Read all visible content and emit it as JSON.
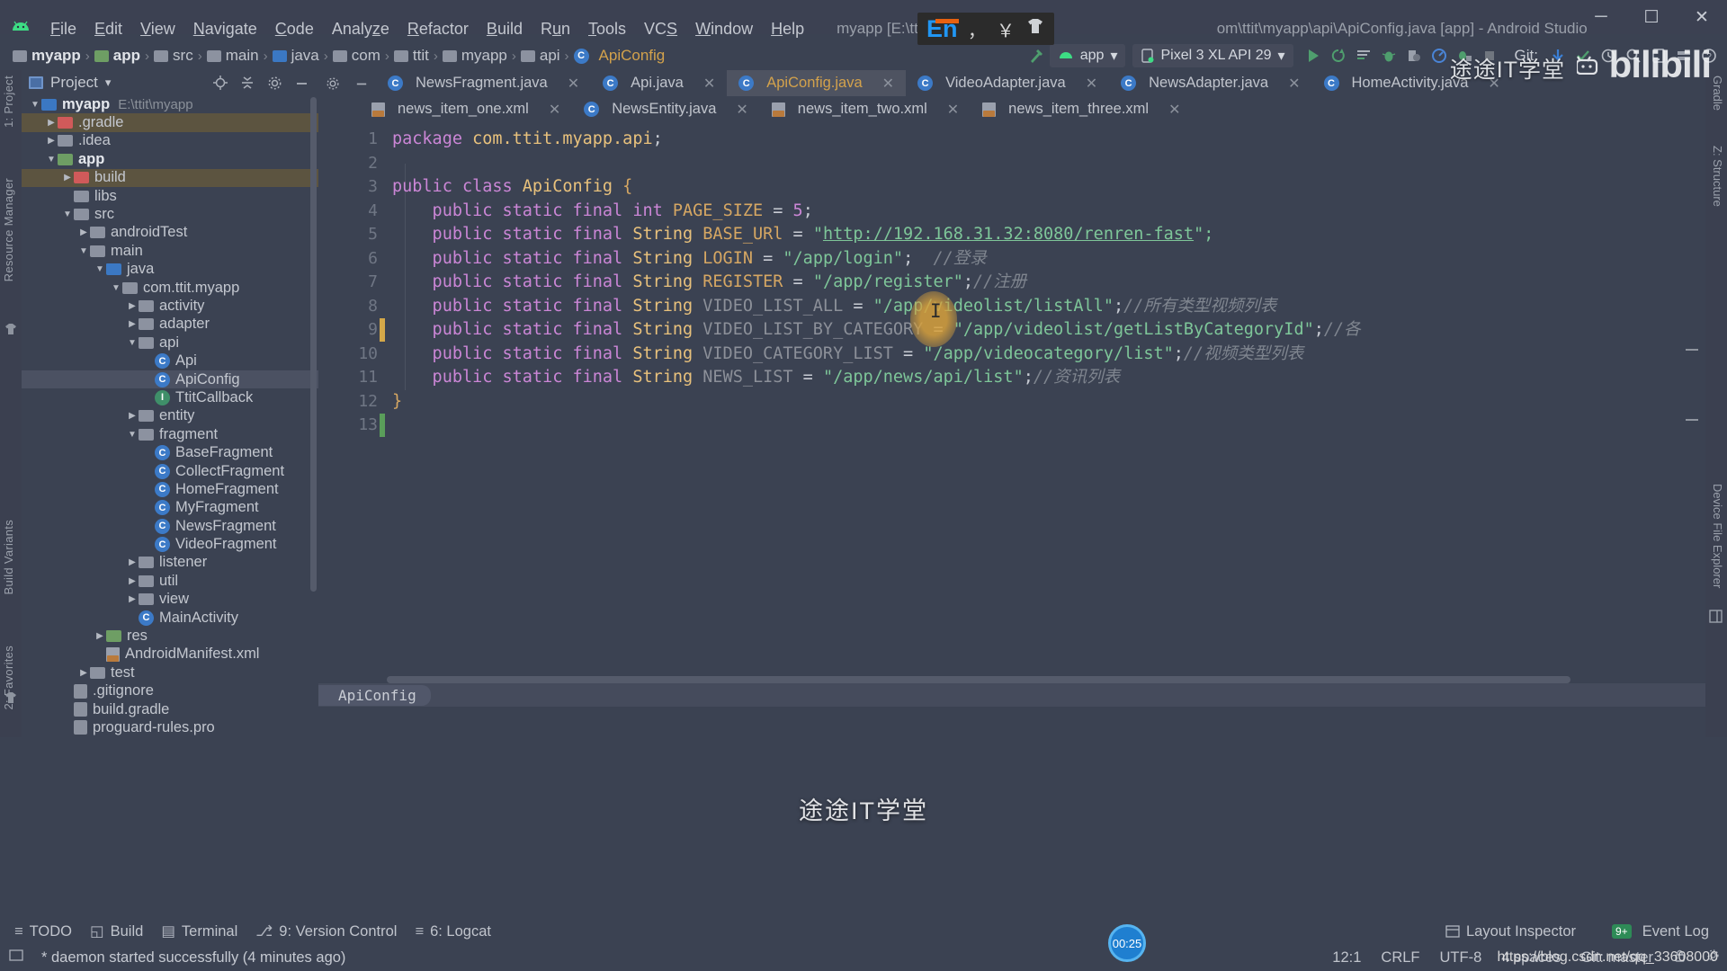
{
  "window": {
    "title": "myapp [E:\\ttit\\myapp] - ...\\ap",
    "title_tail": "om\\ttit\\myapp\\api\\ApiConfig.java [app] - Android Studio",
    "minimize": "─",
    "maximize": "☐",
    "close": "✕"
  },
  "menu": {
    "items": [
      "File",
      "Edit",
      "View",
      "Navigate",
      "Code",
      "Analyze",
      "Refactor",
      "Build",
      "Run",
      "Tools",
      "VCS",
      "Window",
      "Help"
    ]
  },
  "ime": {
    "lang": "En",
    "punct": "，",
    "currency": "￥",
    "shirt": "👕"
  },
  "watermark": {
    "brand": "途途IT学堂",
    "bili": "bilibili",
    "center": "途途IT学堂",
    "blog": "https://blog.csdn.net/qq_33608000"
  },
  "breadcrumb": {
    "items": [
      {
        "label": "myapp",
        "icon": "folder-gray",
        "bold": true
      },
      {
        "label": "app",
        "icon": "folder-green",
        "bold": true
      },
      {
        "label": "src",
        "icon": "folder-gray",
        "bold": false
      },
      {
        "label": "main",
        "icon": "folder-gray",
        "bold": false
      },
      {
        "label": "java",
        "icon": "folder-blue",
        "bold": false
      },
      {
        "label": "com",
        "icon": "folder-gray",
        "bold": false
      },
      {
        "label": "ttit",
        "icon": "folder-gray",
        "bold": false
      },
      {
        "label": "myapp",
        "icon": "folder-gray",
        "bold": false
      },
      {
        "label": "api",
        "icon": "folder-gray",
        "bold": false
      },
      {
        "label": "ApiConfig",
        "icon": "class",
        "bold": false
      }
    ],
    "separator": "›"
  },
  "toolbar": {
    "module_chip": "app",
    "device_chip": "Pixel 3 XL API 29",
    "dropdown_caret": "▾",
    "git_label": "Git:",
    "icons": [
      "hammer-icon",
      "run-icon",
      "rerun-icon",
      "apply-changes-icon",
      "debug-icon",
      "profile-icon",
      "analyze-icon",
      "attach-debugger-icon",
      "stop-icon",
      "vcs-update-icon",
      "vcs-commit-icon",
      "vcs-history-icon",
      "search-icon",
      "avd-manager-icon",
      "sdk-manager-icon",
      "settings-icon"
    ]
  },
  "left_strip": {
    "project": "1: Project",
    "resource_manager": "Resource Manager",
    "build_variants": "Build Variants",
    "favorites": "2: Favorites"
  },
  "right_strip": {
    "gradle": "Gradle",
    "structure": "Z: Structure",
    "device_file_explorer": "Device File Explorer"
  },
  "project_panel": {
    "title": "Project",
    "caret": "▾",
    "locate_icon": "locate-icon",
    "collapse_icon": "collapse-all-icon",
    "minimize_icon": "minimize-icon",
    "tree": [
      {
        "depth": 0,
        "arrow": "down",
        "icon": "folder-blue-module",
        "label": "myapp",
        "bold": true,
        "path": "E:\\ttit\\myapp",
        "highlight": ""
      },
      {
        "depth": 1,
        "arrow": "right",
        "icon": "folder-red",
        "label": ".gradle",
        "bold": false,
        "path": "",
        "highlight": "tan"
      },
      {
        "depth": 1,
        "arrow": "right",
        "icon": "folder-gray",
        "label": ".idea",
        "bold": false,
        "path": "",
        "highlight": ""
      },
      {
        "depth": 1,
        "arrow": "down",
        "icon": "folder-module-green",
        "label": "app",
        "bold": true,
        "path": "",
        "highlight": ""
      },
      {
        "depth": 2,
        "arrow": "right",
        "icon": "folder-red",
        "label": "build",
        "bold": false,
        "path": "",
        "highlight": "tan"
      },
      {
        "depth": 2,
        "arrow": "none",
        "icon": "folder-gray",
        "label": "libs",
        "bold": false,
        "path": "",
        "highlight": ""
      },
      {
        "depth": 2,
        "arrow": "down",
        "icon": "folder-gray",
        "label": "src",
        "bold": false,
        "path": "",
        "highlight": ""
      },
      {
        "depth": 3,
        "arrow": "right",
        "icon": "folder-gray",
        "label": "androidTest",
        "bold": false,
        "path": "",
        "highlight": ""
      },
      {
        "depth": 3,
        "arrow": "down",
        "icon": "folder-gray",
        "label": "main",
        "bold": false,
        "path": "",
        "highlight": ""
      },
      {
        "depth": 4,
        "arrow": "down",
        "icon": "folder-blue",
        "label": "java",
        "bold": false,
        "path": "",
        "highlight": ""
      },
      {
        "depth": 5,
        "arrow": "down",
        "icon": "folder-gray",
        "label": "com.ttit.myapp",
        "bold": false,
        "path": "",
        "highlight": ""
      },
      {
        "depth": 6,
        "arrow": "right",
        "icon": "folder-gray",
        "label": "activity",
        "bold": false,
        "path": "",
        "highlight": ""
      },
      {
        "depth": 6,
        "arrow": "right",
        "icon": "folder-gray",
        "label": "adapter",
        "bold": false,
        "path": "",
        "highlight": ""
      },
      {
        "depth": 6,
        "arrow": "down",
        "icon": "folder-gray",
        "label": "api",
        "bold": false,
        "path": "",
        "highlight": ""
      },
      {
        "depth": 7,
        "arrow": "none",
        "icon": "class",
        "label": "Api",
        "bold": false,
        "path": "",
        "highlight": ""
      },
      {
        "depth": 7,
        "arrow": "none",
        "icon": "class",
        "label": "ApiConfig",
        "bold": false,
        "path": "",
        "highlight": "selected"
      },
      {
        "depth": 7,
        "arrow": "none",
        "icon": "interface",
        "label": "TtitCallback",
        "bold": false,
        "path": "",
        "highlight": ""
      },
      {
        "depth": 6,
        "arrow": "right",
        "icon": "folder-gray",
        "label": "entity",
        "bold": false,
        "path": "",
        "highlight": ""
      },
      {
        "depth": 6,
        "arrow": "down",
        "icon": "folder-gray",
        "label": "fragment",
        "bold": false,
        "path": "",
        "highlight": ""
      },
      {
        "depth": 7,
        "arrow": "none",
        "icon": "class",
        "label": "BaseFragment",
        "bold": false,
        "path": "",
        "highlight": ""
      },
      {
        "depth": 7,
        "arrow": "none",
        "icon": "class",
        "label": "CollectFragment",
        "bold": false,
        "path": "",
        "highlight": ""
      },
      {
        "depth": 7,
        "arrow": "none",
        "icon": "class",
        "label": "HomeFragment",
        "bold": false,
        "path": "",
        "highlight": ""
      },
      {
        "depth": 7,
        "arrow": "none",
        "icon": "class",
        "label": "MyFragment",
        "bold": false,
        "path": "",
        "highlight": ""
      },
      {
        "depth": 7,
        "arrow": "none",
        "icon": "class",
        "label": "NewsFragment",
        "bold": false,
        "path": "",
        "highlight": ""
      },
      {
        "depth": 7,
        "arrow": "none",
        "icon": "class",
        "label": "VideoFragment",
        "bold": false,
        "path": "",
        "highlight": ""
      },
      {
        "depth": 6,
        "arrow": "right",
        "icon": "folder-gray",
        "label": "listener",
        "bold": false,
        "path": "",
        "highlight": ""
      },
      {
        "depth": 6,
        "arrow": "right",
        "icon": "folder-gray",
        "label": "util",
        "bold": false,
        "path": "",
        "highlight": ""
      },
      {
        "depth": 6,
        "arrow": "right",
        "icon": "folder-gray",
        "label": "view",
        "bold": false,
        "path": "",
        "highlight": ""
      },
      {
        "depth": 6,
        "arrow": "none",
        "icon": "class",
        "label": "MainActivity",
        "bold": false,
        "path": "",
        "highlight": ""
      },
      {
        "depth": 4,
        "arrow": "right",
        "icon": "folder-res",
        "label": "res",
        "bold": false,
        "path": "",
        "highlight": ""
      },
      {
        "depth": 4,
        "arrow": "none",
        "icon": "xml",
        "label": "AndroidManifest.xml",
        "bold": false,
        "path": "",
        "highlight": ""
      },
      {
        "depth": 3,
        "arrow": "right",
        "icon": "folder-gray",
        "label": "test",
        "bold": false,
        "path": "",
        "highlight": ""
      },
      {
        "depth": 2,
        "arrow": "none",
        "icon": "file",
        "label": ".gitignore",
        "bold": false,
        "path": "",
        "highlight": ""
      },
      {
        "depth": 2,
        "arrow": "none",
        "icon": "file",
        "label": "build.gradle",
        "bold": false,
        "path": "",
        "highlight": ""
      },
      {
        "depth": 2,
        "arrow": "none",
        "icon": "file",
        "label": "proguard-rules.pro",
        "bold": false,
        "path": "",
        "highlight": ""
      }
    ]
  },
  "editor": {
    "tabs_row1": [
      {
        "label": "NewsFragment.java",
        "icon": "class",
        "active": false,
        "close": "✕"
      },
      {
        "label": "Api.java",
        "icon": "class",
        "active": false,
        "close": "✕"
      },
      {
        "label": "ApiConfig.java",
        "icon": "class",
        "active": true,
        "close": "✕"
      },
      {
        "label": "VideoAdapter.java",
        "icon": "class",
        "active": false,
        "close": "✕"
      },
      {
        "label": "NewsAdapter.java",
        "icon": "class",
        "active": false,
        "close": "✕"
      },
      {
        "label": "HomeActivity.java",
        "icon": "class",
        "active": false,
        "close": "✕"
      }
    ],
    "tabs_row2": [
      {
        "label": "news_item_one.xml",
        "icon": "xml",
        "active": false,
        "close": "✕"
      },
      {
        "label": "NewsEntity.java",
        "icon": "class",
        "active": false,
        "close": "✕"
      },
      {
        "label": "news_item_two.xml",
        "icon": "xml",
        "active": false,
        "close": "✕"
      },
      {
        "label": "news_item_three.xml",
        "icon": "xml",
        "active": false,
        "close": "✕"
      }
    ],
    "line_numbers": [
      "1",
      "2",
      "3",
      "4",
      "5",
      "6",
      "7",
      "8",
      "9",
      "10",
      "11",
      "12",
      "13"
    ],
    "bottom_breadcrumb": "ApiConfig",
    "code": [
      {
        "n": 1,
        "tokens": [
          {
            "t": "package ",
            "c": "kw"
          },
          {
            "t": "com.ttit.myapp.api",
            "c": "cls"
          },
          {
            "t": ";",
            "c": "pun"
          }
        ]
      },
      {
        "n": 2,
        "tokens": []
      },
      {
        "n": 3,
        "tokens": [
          {
            "t": "public class ",
            "c": "kw"
          },
          {
            "t": "ApiConfig",
            "c": "cls"
          },
          {
            "t": " {",
            "c": "cst"
          }
        ]
      },
      {
        "n": 4,
        "tokens": [
          {
            "t": "    public static final ",
            "c": "kw"
          },
          {
            "t": "int ",
            "c": "kw"
          },
          {
            "t": "PAGE_SIZE",
            "c": "cst"
          },
          {
            "t": " = ",
            "c": "pun"
          },
          {
            "t": "5",
            "c": "num"
          },
          {
            "t": ";",
            "c": "pun"
          }
        ]
      },
      {
        "n": 5,
        "tokens": [
          {
            "t": "    public static final ",
            "c": "kw"
          },
          {
            "t": "String ",
            "c": "typ"
          },
          {
            "t": "BASE_URl",
            "c": "cst"
          },
          {
            "t": " = ",
            "c": "pun"
          },
          {
            "t": "\"",
            "c": "str"
          },
          {
            "t": "http://192.168.31.32:8080/renren-fast",
            "c": "link"
          },
          {
            "t": "\";",
            "c": "str"
          }
        ]
      },
      {
        "n": 6,
        "tokens": [
          {
            "t": "    public static final ",
            "c": "kw"
          },
          {
            "t": "String ",
            "c": "typ"
          },
          {
            "t": "LOGIN",
            "c": "cst"
          },
          {
            "t": " = ",
            "c": "pun"
          },
          {
            "t": "\"/app/login\"",
            "c": "str"
          },
          {
            "t": ";",
            "c": "pun"
          },
          {
            "t": "  //登录",
            "c": "cmt"
          }
        ]
      },
      {
        "n": 7,
        "tokens": [
          {
            "t": "    public static final ",
            "c": "kw"
          },
          {
            "t": "String ",
            "c": "typ"
          },
          {
            "t": "REGISTER",
            "c": "cst"
          },
          {
            "t": " = ",
            "c": "pun"
          },
          {
            "t": "\"/app/register\"",
            "c": "str"
          },
          {
            "t": ";",
            "c": "pun"
          },
          {
            "t": "//注册",
            "c": "cmt"
          }
        ]
      },
      {
        "n": 8,
        "tokens": [
          {
            "t": "    public static final ",
            "c": "kw"
          },
          {
            "t": "String ",
            "c": "typ"
          },
          {
            "t": "VIDEO_LIST_ALL",
            "c": "cst-dim"
          },
          {
            "t": " = ",
            "c": "pun"
          },
          {
            "t": "\"/app/videolist/listAll\"",
            "c": "str"
          },
          {
            "t": ";",
            "c": "pun"
          },
          {
            "t": "//所有类型视频列表",
            "c": "cmt"
          }
        ]
      },
      {
        "n": 9,
        "tokens": [
          {
            "t": "    public static final ",
            "c": "kw"
          },
          {
            "t": "String ",
            "c": "typ"
          },
          {
            "t": "VIDEO_LIST_BY_CATEGORY",
            "c": "cst-dim"
          },
          {
            "t": " = ",
            "c": "pun"
          },
          {
            "t": "\"/app/videolist/getListByCategoryId\"",
            "c": "str"
          },
          {
            "t": ";",
            "c": "pun"
          },
          {
            "t": "//各",
            "c": "cmt"
          }
        ]
      },
      {
        "n": 10,
        "tokens": [
          {
            "t": "    public static final ",
            "c": "kw"
          },
          {
            "t": "String ",
            "c": "typ"
          },
          {
            "t": "VIDEO_CATEGORY_LIST",
            "c": "cst-dim"
          },
          {
            "t": " = ",
            "c": "pun"
          },
          {
            "t": "\"/app/videocategory/list\"",
            "c": "str"
          },
          {
            "t": ";",
            "c": "pun"
          },
          {
            "t": "//视频类型列表",
            "c": "cmt"
          }
        ]
      },
      {
        "n": 11,
        "tokens": [
          {
            "t": "    public static final ",
            "c": "kw"
          },
          {
            "t": "String ",
            "c": "typ"
          },
          {
            "t": "NEWS_LIST",
            "c": "cst-dim"
          },
          {
            "t": " = ",
            "c": "pun"
          },
          {
            "t": "\"/app/news/api/list\"",
            "c": "str"
          },
          {
            "t": ";",
            "c": "pun"
          },
          {
            "t": "//资讯列表",
            "c": "cmt"
          }
        ]
      },
      {
        "n": 12,
        "tokens": [
          {
            "t": "}",
            "c": "cst"
          }
        ]
      },
      {
        "n": 13,
        "tokens": []
      }
    ]
  },
  "tool_windows": {
    "items": [
      {
        "label": "TODO",
        "icon": "todo-icon",
        "num": ""
      },
      {
        "label": "Build",
        "icon": "build-icon",
        "num": ""
      },
      {
        "label": "Terminal",
        "icon": "terminal-icon",
        "num": ""
      },
      {
        "label": "9: Version Control",
        "icon": "vcs-icon",
        "num": "9"
      },
      {
        "label": "6: Logcat",
        "icon": "logcat-icon",
        "num": "6"
      }
    ],
    "right": [
      {
        "label": "Layout Inspector",
        "icon": "layout-inspector-icon",
        "badge": ""
      },
      {
        "label": "Event Log",
        "icon": "event-log-icon",
        "badge": "9+"
      }
    ]
  },
  "status_bar": {
    "message": "* daemon started successfully (4 minutes ago)",
    "caret_position": "12:1",
    "line_separator": "CRLF",
    "encoding": "UTF-8",
    "indent": "4 spaces",
    "branch": "Git: master",
    "lock_icon": "lock-icon",
    "gear_icon": "gear-icon",
    "recording_time": "00:25"
  },
  "colors": {
    "bg": "#3b4252",
    "panel": "#3b4252",
    "accent_keyword": "#cb86d6",
    "accent_string": "#7ec699",
    "accent_const": "#d6a763",
    "accent_class": "#e8c17c",
    "comment": "#7f858f",
    "tab_active": "#4e5361",
    "highlight_tan": "#5c5440",
    "selection": "#4b5162"
  }
}
